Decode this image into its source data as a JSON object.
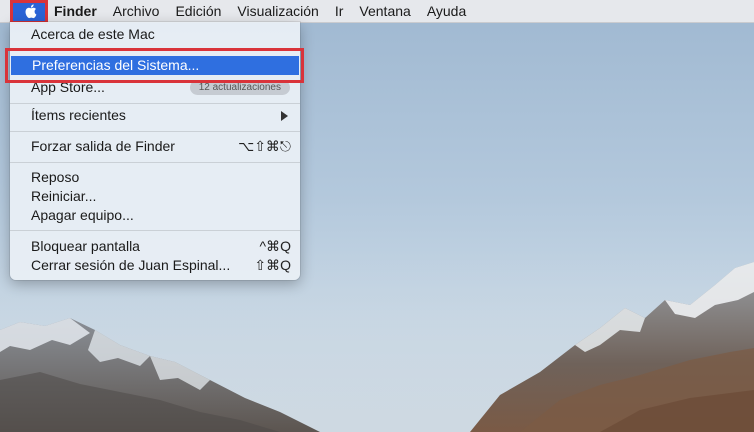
{
  "menubar": {
    "apple_icon": "apple-logo-icon",
    "titles": [
      "Finder",
      "Archivo",
      "Edición",
      "Visualización",
      "Ir",
      "Ventana",
      "Ayuda"
    ]
  },
  "apple_menu": {
    "about": "Acerca de este Mac",
    "system_prefs": "Preferencias del Sistema...",
    "app_store": "App Store...",
    "app_store_badge": "12 actualizaciones",
    "recent_items": "Ítems recientes",
    "force_quit": "Forzar salida de Finder",
    "force_quit_shortcut": "⌥⇧⌘⎋",
    "sleep": "Reposo",
    "restart": "Reiniciar...",
    "shutdown": "Apagar equipo...",
    "lock_screen": "Bloquear pantalla",
    "lock_screen_shortcut": "^⌘Q",
    "logout": "Cerrar sesión de Juan Espinal...",
    "logout_shortcut": "⇧⌘Q"
  },
  "colors": {
    "highlight_red": "#d9333a",
    "selection_blue": "#2f6fe0",
    "apple_button_blue": "#2a63d6"
  }
}
